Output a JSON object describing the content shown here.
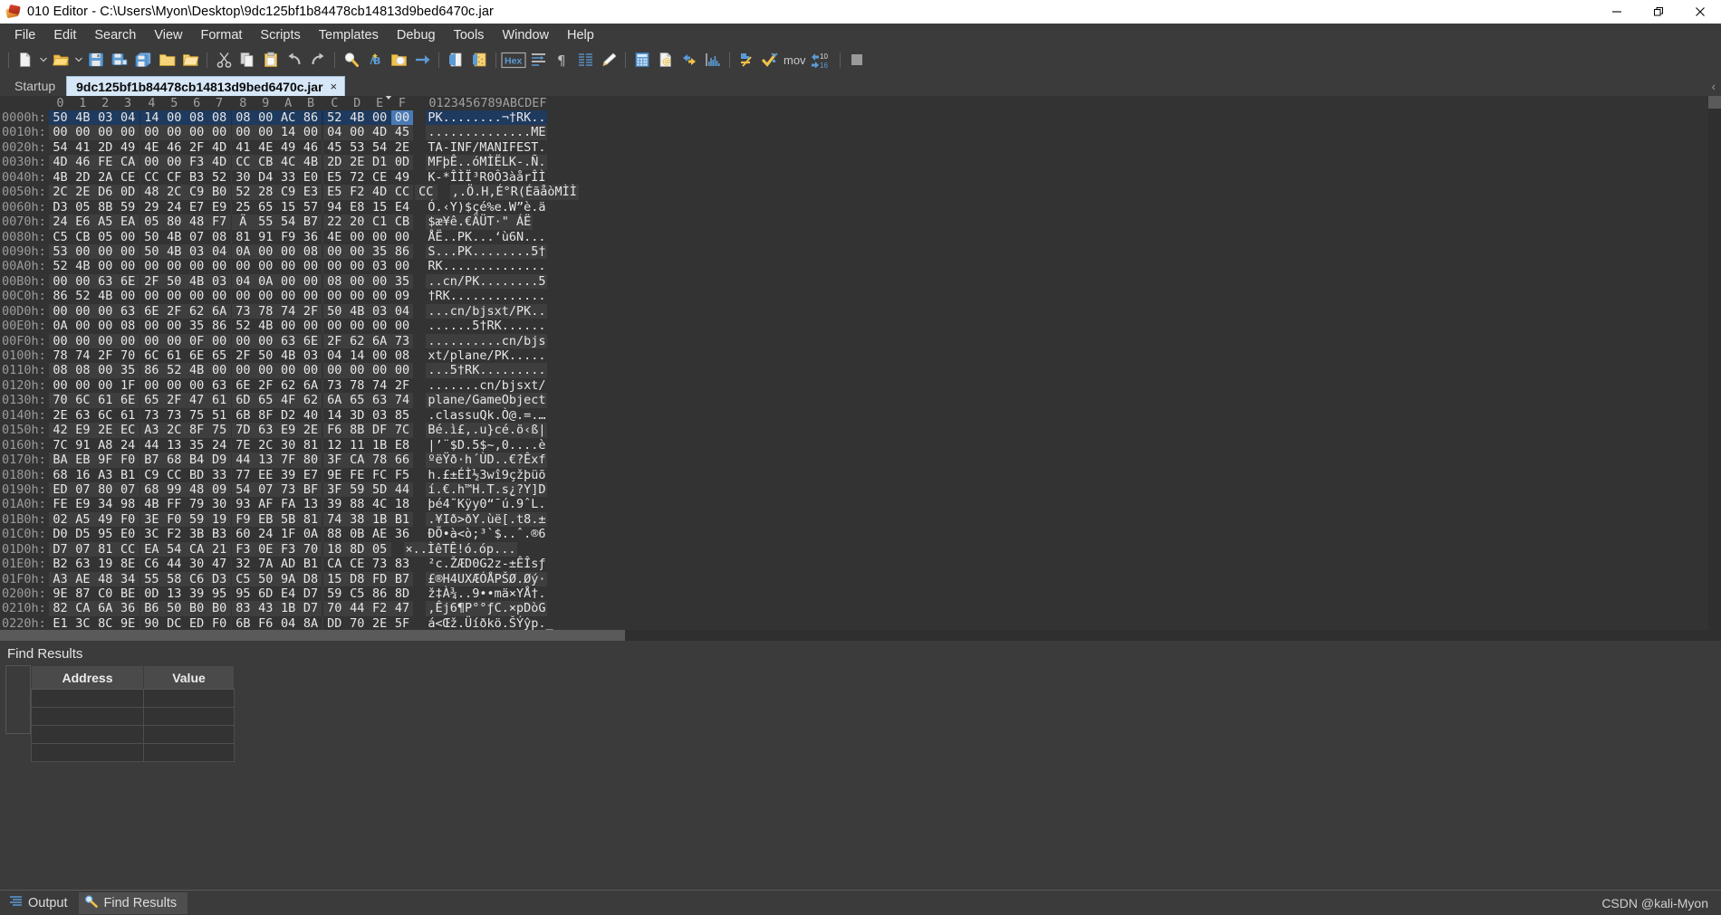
{
  "window": {
    "title": "010 Editor - C:\\Users\\Myon\\Desktop\\9dc125bf1b84478cb14813d9bed6470c.jar",
    "app_icon": "010-editor-icon",
    "minimize_label": "minimize-icon",
    "maximize_label": "maximize-icon",
    "close_label": "close-icon"
  },
  "menubar": {
    "items": [
      {
        "label": "File"
      },
      {
        "label": "Edit"
      },
      {
        "label": "Search"
      },
      {
        "label": "View"
      },
      {
        "label": "Format"
      },
      {
        "label": "Scripts"
      },
      {
        "label": "Templates"
      },
      {
        "label": "Debug"
      },
      {
        "label": "Tools"
      },
      {
        "label": "Window"
      },
      {
        "label": "Help"
      }
    ]
  },
  "toolbar": {
    "hex_label": "Hex",
    "mov_label": "mov",
    "base_label": "10",
    "items": [
      {
        "name": "new-file-icon"
      },
      {
        "name": "new-file-dropdown-caret-icon"
      },
      {
        "name": "open-file-icon"
      },
      {
        "name": "open-file-dropdown-caret-icon"
      },
      {
        "name": "save-icon"
      },
      {
        "name": "save-as-icon"
      },
      {
        "name": "save-all-icon"
      },
      {
        "name": "open-folder-icon"
      },
      {
        "name": "open-project-icon"
      },
      {
        "name": "cut-icon"
      },
      {
        "name": "copy-icon"
      },
      {
        "name": "paste-icon"
      },
      {
        "name": "undo-icon"
      },
      {
        "name": "redo-icon"
      },
      {
        "name": "find-icon"
      },
      {
        "name": "replace-icon"
      },
      {
        "name": "find-in-files-icon"
      },
      {
        "name": "goto-icon"
      },
      {
        "name": "run-template-icon"
      },
      {
        "name": "run-script-icon"
      },
      {
        "name": "hex-mode-icon"
      },
      {
        "name": "text-wrap-icon"
      },
      {
        "name": "show-paragraph-icon"
      },
      {
        "name": "line-numbers-icon"
      },
      {
        "name": "highlight-icon"
      },
      {
        "name": "calculator-icon"
      },
      {
        "name": "file-info-icon"
      },
      {
        "name": "compare-icon"
      },
      {
        "name": "histogram-icon"
      },
      {
        "name": "checksum-icon"
      },
      {
        "name": "check-syntax-icon"
      },
      {
        "name": "disassemble-icon"
      },
      {
        "name": "base-converter-icon"
      },
      {
        "name": "stop-icon"
      }
    ]
  },
  "tabs": {
    "items": [
      {
        "label": "Startup",
        "active": false,
        "closable": false
      },
      {
        "label": "9dc125bf1b84478cb14813d9bed6470c.jar",
        "active": true,
        "closable": true,
        "close_glyph": "×"
      }
    ]
  },
  "hex_editor": {
    "column_headers": [
      "0",
      "1",
      "2",
      "3",
      "4",
      "5",
      "6",
      "7",
      "8",
      "9",
      "A",
      "B",
      "C",
      "D",
      "E",
      "F"
    ],
    "ascii_header": "0123456789ABCDEF",
    "selected_row_index": 0,
    "rows": [
      {
        "addr": "0000h:",
        "bytes": [
          "50",
          "4B",
          "03",
          "04",
          "14",
          "00",
          "08",
          "08",
          "08",
          "00",
          "AC",
          "86",
          "52",
          "4B",
          "00",
          "00"
        ],
        "ascii": "PK........¬†RK.."
      },
      {
        "addr": "0010h:",
        "bytes": [
          "00",
          "00",
          "00",
          "00",
          "00",
          "00",
          "00",
          "00",
          "00",
          "00",
          "14",
          "00",
          "04",
          "00",
          "4D",
          "45"
        ],
        "ascii": "..............ME"
      },
      {
        "addr": "0020h:",
        "bytes": [
          "54",
          "41",
          "2D",
          "49",
          "4E",
          "46",
          "2F",
          "4D",
          "41",
          "4E",
          "49",
          "46",
          "45",
          "53",
          "54",
          "2E"
        ],
        "ascii": "TA-INF/MANIFEST."
      },
      {
        "addr": "0030h:",
        "bytes": [
          "4D",
          "46",
          "FE",
          "CA",
          "00",
          "00",
          "F3",
          "4D",
          "CC",
          "CB",
          "4C",
          "4B",
          "2D",
          "2E",
          "D1",
          "0D"
        ],
        "ascii": "MFþÊ..óMÌËLK-.Ñ."
      },
      {
        "addr": "0040h:",
        "bytes": [
          "4B",
          "2D",
          "2A",
          "CE",
          "CC",
          "CF",
          "B3",
          "52",
          "30",
          "D4",
          "33",
          "E0",
          "E5",
          "72",
          "CE",
          "49"
        ],
        "ascii": "K-*ÎÌÏ³R0Ô3àårÎÌ"
      },
      {
        "addr": "0050h:",
        "bytes": [
          "2C",
          "2E",
          "D6",
          "0D",
          "48",
          "2C",
          "C9",
          "B0",
          "52",
          "28",
          "C9",
          "E3",
          "E5",
          "F2",
          "4D",
          "CC",
          "CC"
        ],
        "ascii": ",.Ö.H,É°R(ÉãåòMÌÌ"
      },
      {
        "addr": "0060h:",
        "bytes": [
          "D3",
          "05",
          "8B",
          "59",
          "29",
          "24",
          "E7",
          "E9",
          "25",
          "65",
          "15",
          "57",
          "94",
          "E8",
          "15",
          "E4"
        ],
        "ascii": "Ó.‹Y)$çé%e.W”è.ä"
      },
      {
        "addr": "0070h:",
        "bytes": [
          "24",
          "E6",
          "A5",
          "EA",
          "05",
          "80",
          "48",
          "F7",
          "Ä",
          "55",
          "54",
          "B7",
          "22",
          "20",
          "C1",
          "CB"
        ],
        "ascii": "$æ¥ê.€ÄÜT·\" ÁË"
      },
      {
        "addr": "0080h:",
        "bytes": [
          "C5",
          "CB",
          "05",
          "00",
          "50",
          "4B",
          "07",
          "08",
          "81",
          "91",
          "F9",
          "36",
          "4E",
          "00",
          "00",
          "00"
        ],
        "ascii": "ÅË..PK...‘ù6N..."
      },
      {
        "addr": "0090h:",
        "bytes": [
          "53",
          "00",
          "00",
          "00",
          "50",
          "4B",
          "03",
          "04",
          "0A",
          "00",
          "00",
          "08",
          "00",
          "00",
          "35",
          "86"
        ],
        "ascii": "S...PK........5†"
      },
      {
        "addr": "00A0h:",
        "bytes": [
          "52",
          "4B",
          "00",
          "00",
          "00",
          "00",
          "00",
          "00",
          "00",
          "00",
          "00",
          "00",
          "00",
          "00",
          "03",
          "00"
        ],
        "ascii": "RK.............."
      },
      {
        "addr": "00B0h:",
        "bytes": [
          "00",
          "00",
          "63",
          "6E",
          "2F",
          "50",
          "4B",
          "03",
          "04",
          "0A",
          "00",
          "00",
          "08",
          "00",
          "00",
          "35"
        ],
        "ascii": "..cn/PK........5"
      },
      {
        "addr": "00C0h:",
        "bytes": [
          "86",
          "52",
          "4B",
          "00",
          "00",
          "00",
          "00",
          "00",
          "00",
          "00",
          "00",
          "00",
          "00",
          "00",
          "00",
          "09"
        ],
        "ascii": "†RK............."
      },
      {
        "addr": "00D0h:",
        "bytes": [
          "00",
          "00",
          "00",
          "63",
          "6E",
          "2F",
          "62",
          "6A",
          "73",
          "78",
          "74",
          "2F",
          "50",
          "4B",
          "03",
          "04"
        ],
        "ascii": "...cn/bjsxt/PK.."
      },
      {
        "addr": "00E0h:",
        "bytes": [
          "0A",
          "00",
          "00",
          "08",
          "00",
          "00",
          "35",
          "86",
          "52",
          "4B",
          "00",
          "00",
          "00",
          "00",
          "00",
          "00"
        ],
        "ascii": "......5†RK......"
      },
      {
        "addr": "00F0h:",
        "bytes": [
          "00",
          "00",
          "00",
          "00",
          "00",
          "00",
          "0F",
          "00",
          "00",
          "00",
          "63",
          "6E",
          "2F",
          "62",
          "6A",
          "73"
        ],
        "ascii": "..........cn/bjs"
      },
      {
        "addr": "0100h:",
        "bytes": [
          "78",
          "74",
          "2F",
          "70",
          "6C",
          "61",
          "6E",
          "65",
          "2F",
          "50",
          "4B",
          "03",
          "04",
          "14",
          "00",
          "08"
        ],
        "ascii": "xt/plane/PK....."
      },
      {
        "addr": "0110h:",
        "bytes": [
          "08",
          "08",
          "00",
          "35",
          "86",
          "52",
          "4B",
          "00",
          "00",
          "00",
          "00",
          "00",
          "00",
          "00",
          "00",
          "00"
        ],
        "ascii": "...5†RK........."
      },
      {
        "addr": "0120h:",
        "bytes": [
          "00",
          "00",
          "00",
          "1F",
          "00",
          "00",
          "00",
          "63",
          "6E",
          "2F",
          "62",
          "6A",
          "73",
          "78",
          "74",
          "2F"
        ],
        "ascii": ".......cn/bjsxt/"
      },
      {
        "addr": "0130h:",
        "bytes": [
          "70",
          "6C",
          "61",
          "6E",
          "65",
          "2F",
          "47",
          "61",
          "6D",
          "65",
          "4F",
          "62",
          "6A",
          "65",
          "63",
          "74"
        ],
        "ascii": "plane/GameObject"
      },
      {
        "addr": "0140h:",
        "bytes": [
          "2E",
          "63",
          "6C",
          "61",
          "73",
          "73",
          "75",
          "51",
          "6B",
          "8F",
          "D2",
          "40",
          "14",
          "3D",
          "03",
          "85"
        ],
        "ascii": ".classuQk.Ò@.=.…"
      },
      {
        "addr": "0150h:",
        "bytes": [
          "42",
          "E9",
          "2E",
          "EC",
          "A3",
          "2C",
          "8F",
          "75",
          "7D",
          "63",
          "E9",
          "2E",
          "F6",
          "8B",
          "DF",
          "7C"
        ],
        "ascii": "Bé.ì£,.u}cé.ö‹ß|"
      },
      {
        "addr": "0160h:",
        "bytes": [
          "7C",
          "91",
          "A8",
          "24",
          "44",
          "13",
          "35",
          "24",
          "7E",
          "2C",
          "30",
          "81",
          "12",
          "11",
          "1B",
          "E8"
        ],
        "ascii": "|’¨$D.5$~,0....è"
      },
      {
        "addr": "0170h:",
        "bytes": [
          "BA",
          "EB",
          "9F",
          "F0",
          "B7",
          "68",
          "B4",
          "D9",
          "44",
          "13",
          "7F",
          "80",
          "3F",
          "CA",
          "78",
          "66"
        ],
        "ascii": "ºëŸð·h´ÙD..€?Êxf"
      },
      {
        "addr": "0180h:",
        "bytes": [
          "68",
          "16",
          "A3",
          "B1",
          "C9",
          "CC",
          "BD",
          "33",
          "77",
          "EE",
          "39",
          "E7",
          "9E",
          "FE",
          "FC",
          "F5"
        ],
        "ascii": "h.£±ÉÌ½3wî9çžþüõ"
      },
      {
        "addr": "0190h:",
        "bytes": [
          "ED",
          "07",
          "80",
          "07",
          "68",
          "99",
          "48",
          "09",
          "54",
          "07",
          "73",
          "BF",
          "3F",
          "59",
          "5D",
          "44"
        ],
        "ascii": "í.€.h™H.T.s¿?Y]D"
      },
      {
        "addr": "01A0h:",
        "bytes": [
          "FE",
          "E9",
          "34",
          "98",
          "4B",
          "FF",
          "79",
          "30",
          "93",
          "AF",
          "FA",
          "13",
          "39",
          "88",
          "4C",
          "18"
        ],
        "ascii": "þé4˜Kÿy0“¯ú.9ˆL."
      },
      {
        "addr": "01B0h:",
        "bytes": [
          "02",
          "A5",
          "49",
          "F0",
          "3E",
          "F0",
          "59",
          "19",
          "F9",
          "EB",
          "5B",
          "81",
          "74",
          "38",
          "1B",
          "B1"
        ],
        "ascii": ".¥Ið>ðY.ùë[.t8.±"
      },
      {
        "addr": "01C0h:",
        "bytes": [
          "D0",
          "D5",
          "95",
          "E0",
          "3C",
          "F2",
          "3B",
          "B3",
          "60",
          "24",
          "1F",
          "0A",
          "88",
          "0B",
          "AE",
          "36"
        ],
        "ascii": "ÐÕ•à<ò;³`$..ˆ.®6"
      },
      {
        "addr": "01D0h:",
        "bytes": [
          "D7",
          "07",
          "81",
          "CC",
          "EA",
          "54",
          "CA",
          "21",
          "F3",
          "0E",
          "F3",
          "70",
          "18",
          "8D",
          "05"
        ],
        "ascii": "×..ÌêТÊ!ó.óp..."
      },
      {
        "addr": "01E0h:",
        "bytes": [
          "B2",
          "63",
          "19",
          "8E",
          "C6",
          "44",
          "30",
          "47",
          "32",
          "7A",
          "AD",
          "B1",
          "CA",
          "CE",
          "73",
          "83"
        ],
        "ascii": "²c.ŽÆD0G2z-±ÊÎsƒ"
      },
      {
        "addr": "01F0h:",
        "bytes": [
          "A3",
          "AE",
          "48",
          "34",
          "55",
          "58",
          "C6",
          "D3",
          "C5",
          "50",
          "9A",
          "D8",
          "15",
          "D8",
          "FD",
          "B7"
        ],
        "ascii": "£®H4UXÆÓÅPŠØ.Øý·"
      },
      {
        "addr": "0200h:",
        "bytes": [
          "9E",
          "87",
          "C0",
          "BE",
          "0D",
          "13",
          "39",
          "95",
          "95",
          "6D",
          "E4",
          "D7",
          "59",
          "C5",
          "86",
          "8D"
        ],
        "ascii": "ž‡À¾..9••mä×YÅ†."
      },
      {
        "addr": "0210h:",
        "bytes": [
          "82",
          "CA",
          "6A",
          "36",
          "B6",
          "50",
          "B0",
          "B0",
          "83",
          "43",
          "1B",
          "D7",
          "70",
          "44",
          "F2",
          "47"
        ],
        "ascii": ",Êj6¶P°°ƒC.×pDòG"
      },
      {
        "addr": "0220h:",
        "bytes": [
          "E1",
          "3C",
          "8C",
          "9E",
          "90",
          "DC",
          "ED",
          "F0",
          "6B",
          "F6",
          "04",
          "8A",
          "DD",
          "70",
          "2E",
          "5F"
        ],
        "ascii": "á<Œž.Üíðkö.ŠÝŷp._"
      }
    ]
  },
  "find_results": {
    "title": "Find Results",
    "columns": [
      "Address",
      "Value"
    ],
    "rows": []
  },
  "bottom_tabs": {
    "items": [
      {
        "label": "Output",
        "icon": "output-icon",
        "active": false
      },
      {
        "label": "Find Results",
        "icon": "find-results-icon",
        "active": true
      }
    ]
  },
  "watermark": {
    "text": "CSDN @kali-Myon"
  },
  "colors": {
    "app_bg": "#3b3b3b",
    "editor_bg": "#333333",
    "band_alt": "#3e3e3e",
    "selection": "#1e3a5f",
    "caret": "#4a7ab5",
    "tab_active_bg": "#d6e7f7",
    "text": "#e6e6e6",
    "muted_text": "#9b9b9b"
  }
}
